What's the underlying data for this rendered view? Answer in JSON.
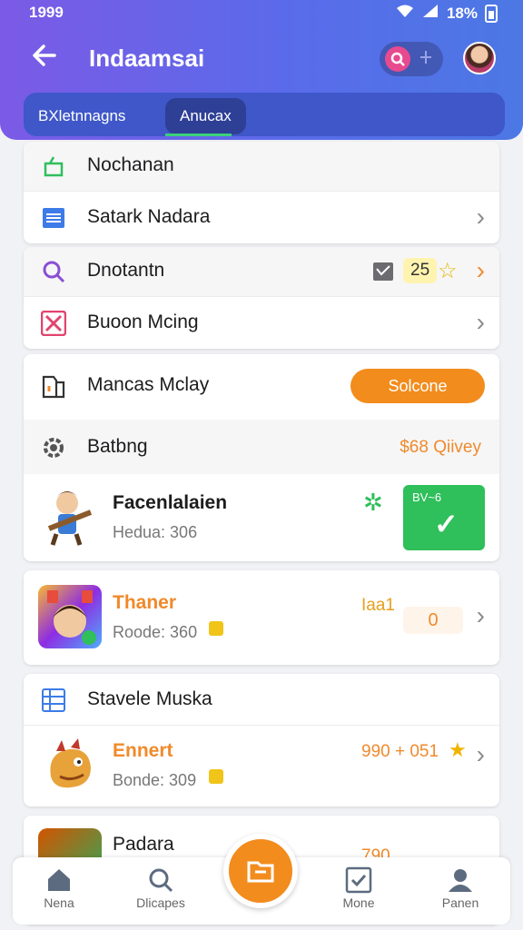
{
  "status": {
    "time": "1999",
    "battery": "18%"
  },
  "header": {
    "title": "Indaamsai",
    "tabs": [
      "BXletnnagns",
      "Anucax"
    ],
    "active_tab": 1
  },
  "card1": {
    "rows": [
      {
        "label": "Nochanan",
        "icon": "bag-icon"
      },
      {
        "label": "Satark Nadara",
        "icon": "list-icon"
      }
    ]
  },
  "card2": {
    "rows": [
      {
        "label": "Dnotantn",
        "icon": "search-icon",
        "badge": "25"
      },
      {
        "label": "Buoon Mcing",
        "icon": "image-icon"
      }
    ]
  },
  "card3": {
    "row1": {
      "label": "Mancas Mclay",
      "button": "Solcone"
    },
    "row2": {
      "label": "Batbng",
      "meta": "$68 Qiivey"
    },
    "game": {
      "title": "Facenlalaien",
      "sub": "Hedua: 306",
      "button": "BV~6"
    }
  },
  "card4": {
    "title": "Thaner",
    "sub": "Roode: 360",
    "meta": "Iaa1",
    "value": "0"
  },
  "card5": {
    "heading": "Stavele Muska",
    "game": {
      "title": "Ennert",
      "sub": "Bonde: 309",
      "meta": "990 + 051"
    }
  },
  "card6": {
    "title": "Padara",
    "meta": "790"
  },
  "nav": [
    {
      "label": "Nena",
      "icon": "home-icon"
    },
    {
      "label": "Dlicapes",
      "icon": "search-icon"
    },
    {
      "label": "Mone",
      "icon": "check-icon"
    },
    {
      "label": "Panen",
      "icon": "person-icon"
    }
  ],
  "colors": {
    "accent": "#f28c1d",
    "header_start": "#7b5ae6",
    "header_end": "#4b78e4",
    "success": "#2fbf5b"
  }
}
